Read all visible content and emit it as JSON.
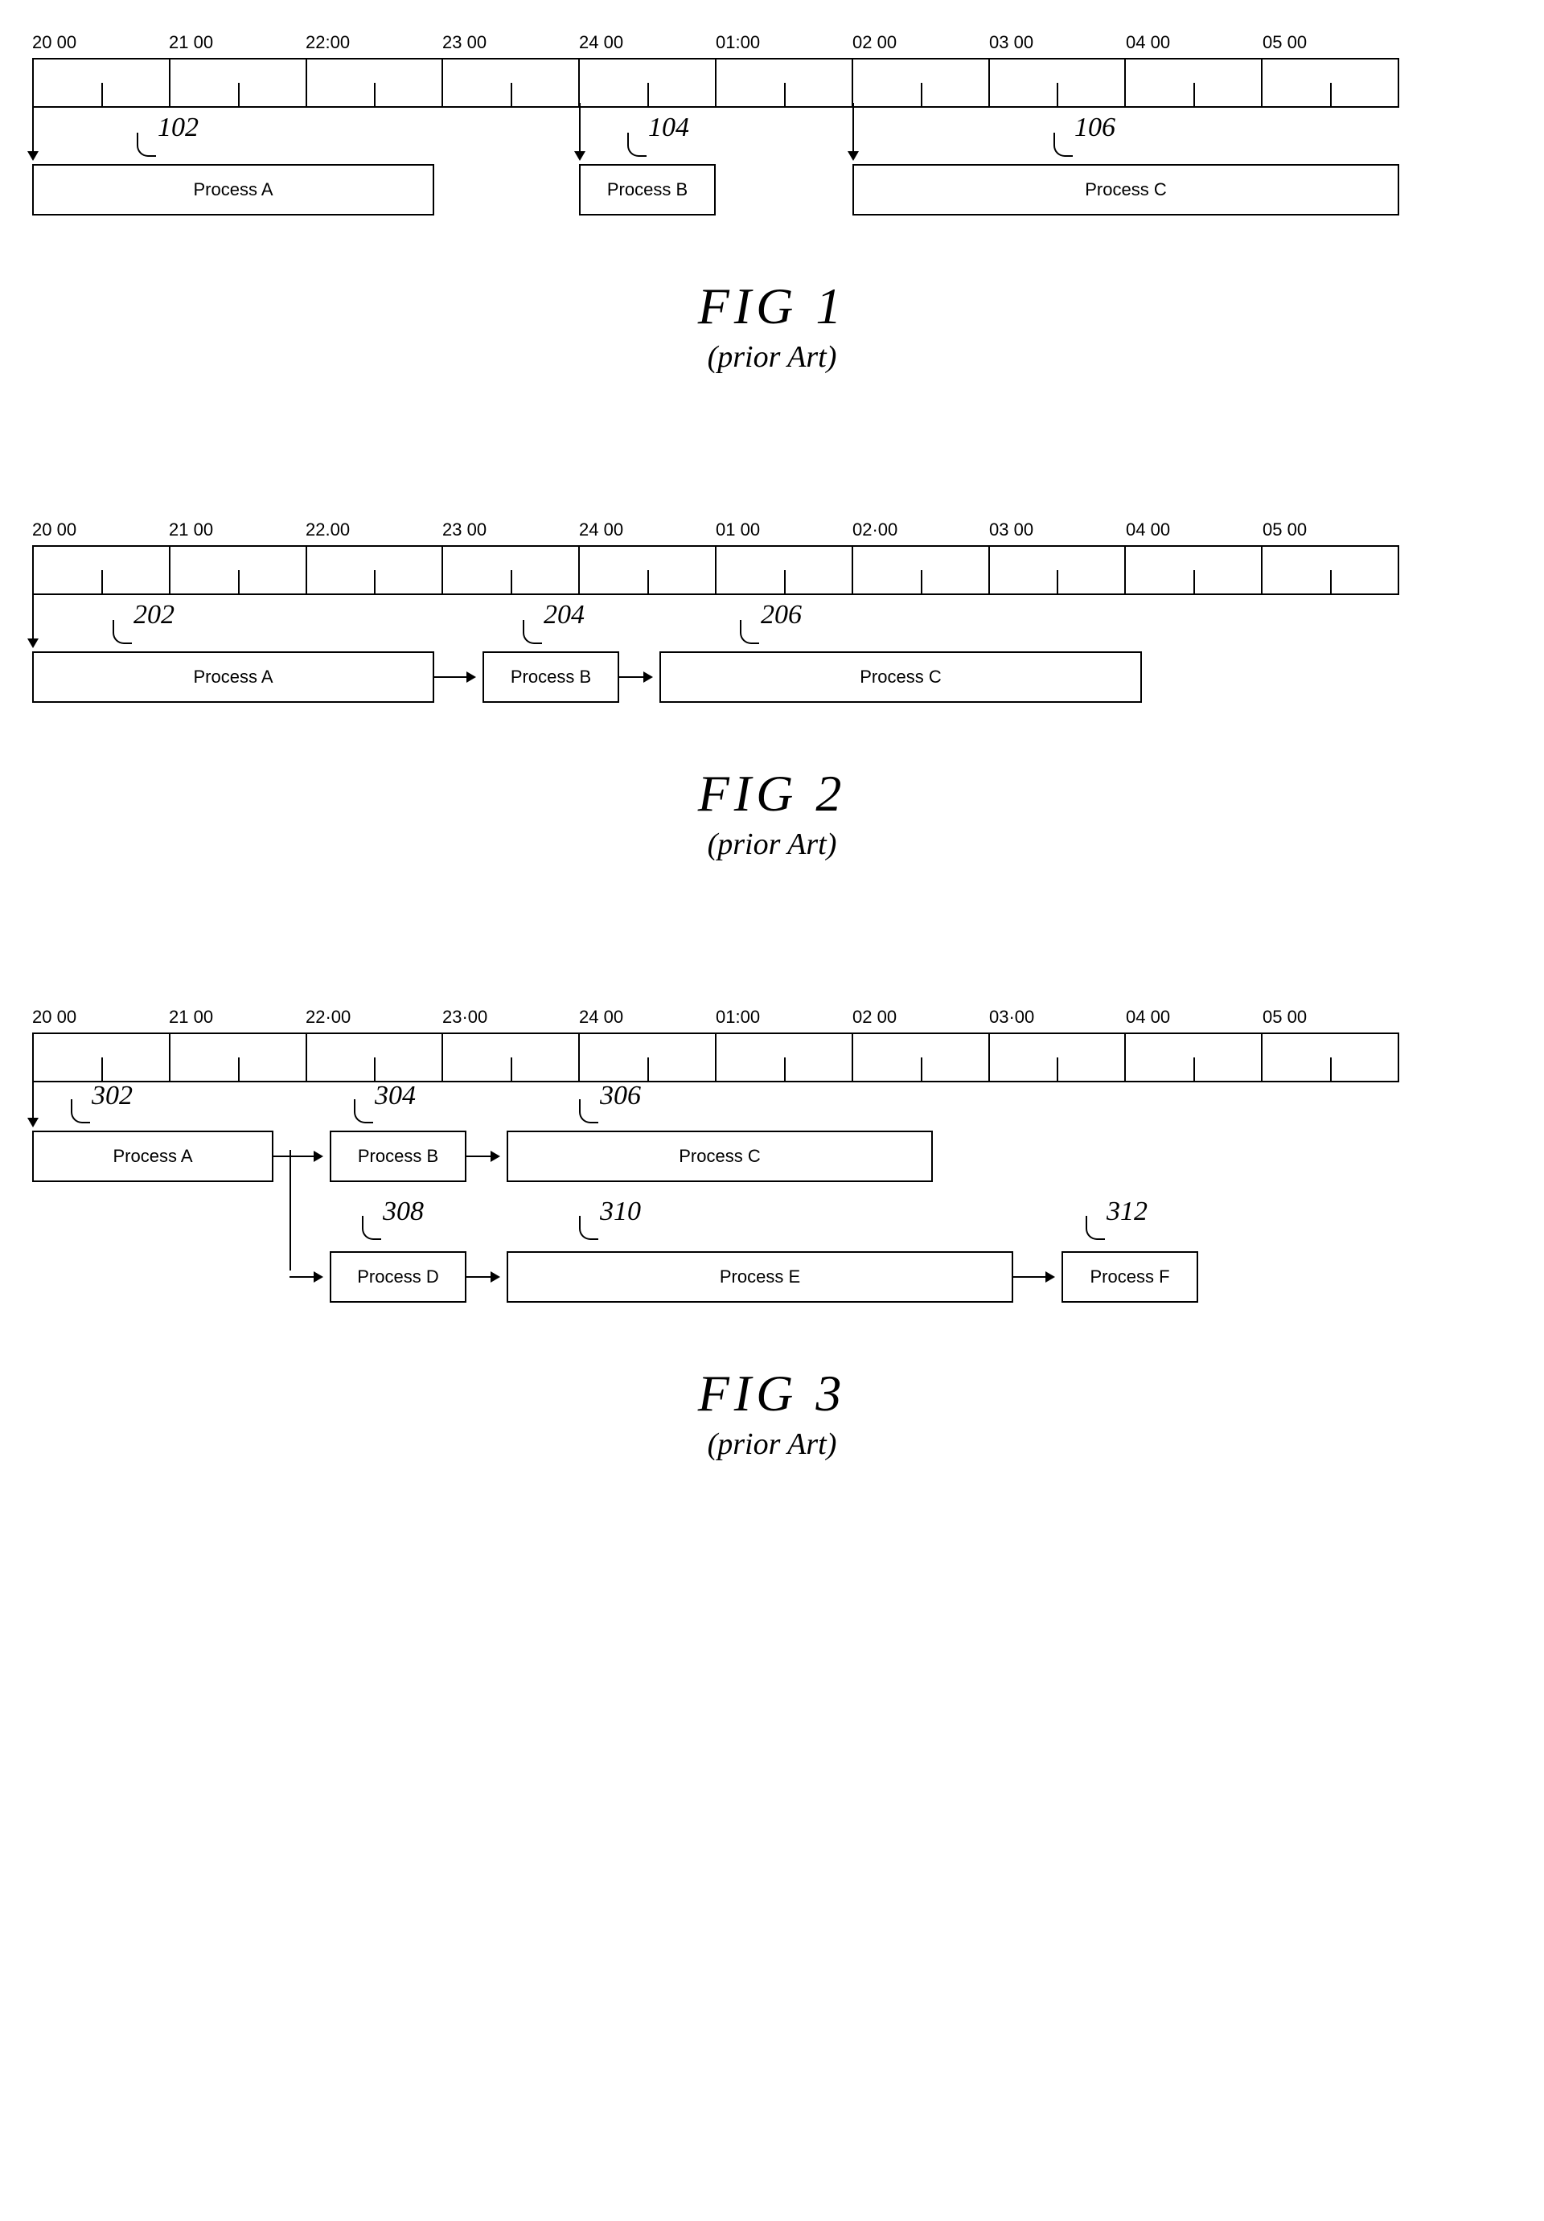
{
  "fig1": {
    "times": [
      "20 00",
      "21 00",
      "22:00",
      "23 00",
      "24 00",
      "01:00",
      "02 00",
      "03 00",
      "04 00",
      "05 00"
    ],
    "pA": "Process A",
    "pB": "Process B",
    "pC": "Process C",
    "ref102": "102",
    "ref104": "104",
    "ref106": "106",
    "title": "FIG 1",
    "sub": "(prior Art)"
  },
  "fig2": {
    "times": [
      "20 00",
      "21 00",
      "22.00",
      "23 00",
      "24 00",
      "01 00",
      "02·00",
      "03 00",
      "04 00",
      "05 00"
    ],
    "pA": "Process A",
    "pB": "Process B",
    "pC": "Process C",
    "ref202": "202",
    "ref204": "204",
    "ref206": "206",
    "title": "FIG 2",
    "sub": "(prior Art)"
  },
  "fig3": {
    "times": [
      "20 00",
      "21 00",
      "22·00",
      "23·00",
      "24 00",
      "01:00",
      "02 00",
      "03·00",
      "04 00",
      "05 00"
    ],
    "pA": "Process A",
    "pB": "Process B",
    "pC": "Process C",
    "pD": "Process D",
    "pE": "Process E",
    "pF": "Process F",
    "ref302": "302",
    "ref304": "304",
    "ref306": "306",
    "ref308": "308",
    "ref310": "310",
    "ref312": "312",
    "title": "FIG 3",
    "sub": "(prior Art)"
  }
}
